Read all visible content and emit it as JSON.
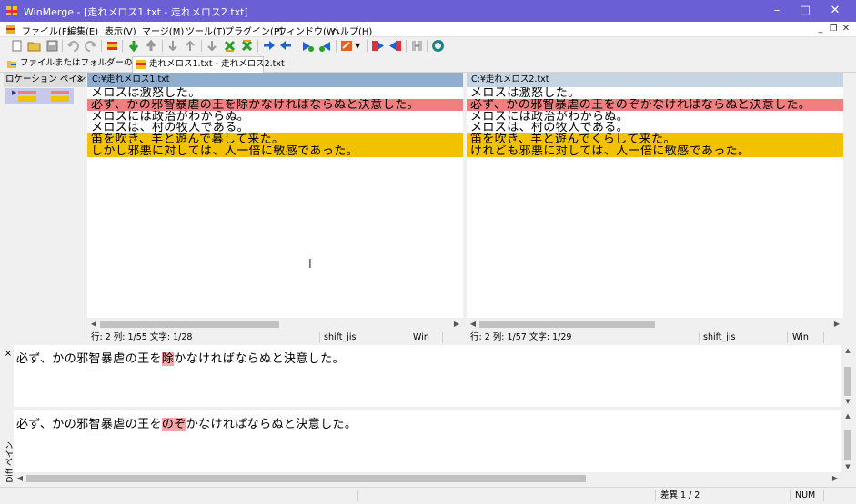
{
  "window": {
    "title": "WinMerge - [走れメロス1.txt - 走れメロス2.txt]"
  },
  "menu": [
    "ファイル(F)",
    "編集(E)",
    "表示(V)",
    "マージ(M)",
    "ツール(T)",
    "プラグイン(P)",
    "ウィンドウ(W)",
    "ヘルプ(H)"
  ],
  "tabs": [
    {
      "label": "ファイルまたはフォルダーの選択..."
    },
    {
      "label": "走れメロス1.txt - 走れメロス2.txt"
    }
  ],
  "location_pane": {
    "title": "ロケーション ペイン",
    "close": "×"
  },
  "left_pane": {
    "path": "C:¥走れメロス1.txt",
    "lines": [
      {
        "text": "メロスは激怒した。",
        "state": "same"
      },
      {
        "text": "必ず、かの邪智暴虐の王を除かなければならぬと決意した。",
        "state": "diff-sel"
      },
      {
        "text": "メロスには政治がわからぬ。",
        "state": "same"
      },
      {
        "text": "メロスは、村の牧人である。",
        "state": "same"
      },
      {
        "text": "笛を吹き、羊と遊んで暮して来た。",
        "state": "diff"
      },
      {
        "text": "しかし邪悪に対しては、人一倍に敏感であった。",
        "state": "diff"
      }
    ],
    "status": {
      "position": "行: 2  列: 1/55  文字: 1/28",
      "encoding": "shift_jis",
      "eol": "Win"
    }
  },
  "right_pane": {
    "path": "C:¥走れメロス2.txt",
    "lines": [
      {
        "text": "メロスは激怒した。",
        "state": "same"
      },
      {
        "text": "必ず、かの邪智暴虐の王をのぞかなければならぬと決意した。",
        "state": "diff-sel"
      },
      {
        "text": "メロスには政治がわからぬ。",
        "state": "same"
      },
      {
        "text": "メロスは、村の牧人である。",
        "state": "same"
      },
      {
        "text": "笛を吹き、羊と遊んでくらして来た。",
        "state": "diff"
      },
      {
        "text": "けれども邪悪に対しては、人一倍に敏感であった。",
        "state": "diff"
      }
    ],
    "status": {
      "position": "行: 2  列: 1/57  文字: 1/29",
      "encoding": "shift_jis",
      "eol": "Win"
    }
  },
  "diff_pane": {
    "title": "Diff ペイン",
    "close": "×",
    "top": {
      "before": "必ず、かの邪智暴虐の王を",
      "changed": "除",
      "after": "かなければならぬと決意した。"
    },
    "bottom": {
      "before": "必ず、かの邪智暴虐の王を",
      "changed": "のぞ",
      "after": "かなければならぬと決意した。"
    }
  },
  "status_bar": {
    "diff_count": "差異 1 / 2",
    "num": "NUM"
  },
  "colors": {
    "title_bar": "#6b5fd5",
    "selected_diff": "#f08080",
    "diff": "#f2c200",
    "path_left": "#8faed0",
    "path_right": "#c5d5e3"
  }
}
